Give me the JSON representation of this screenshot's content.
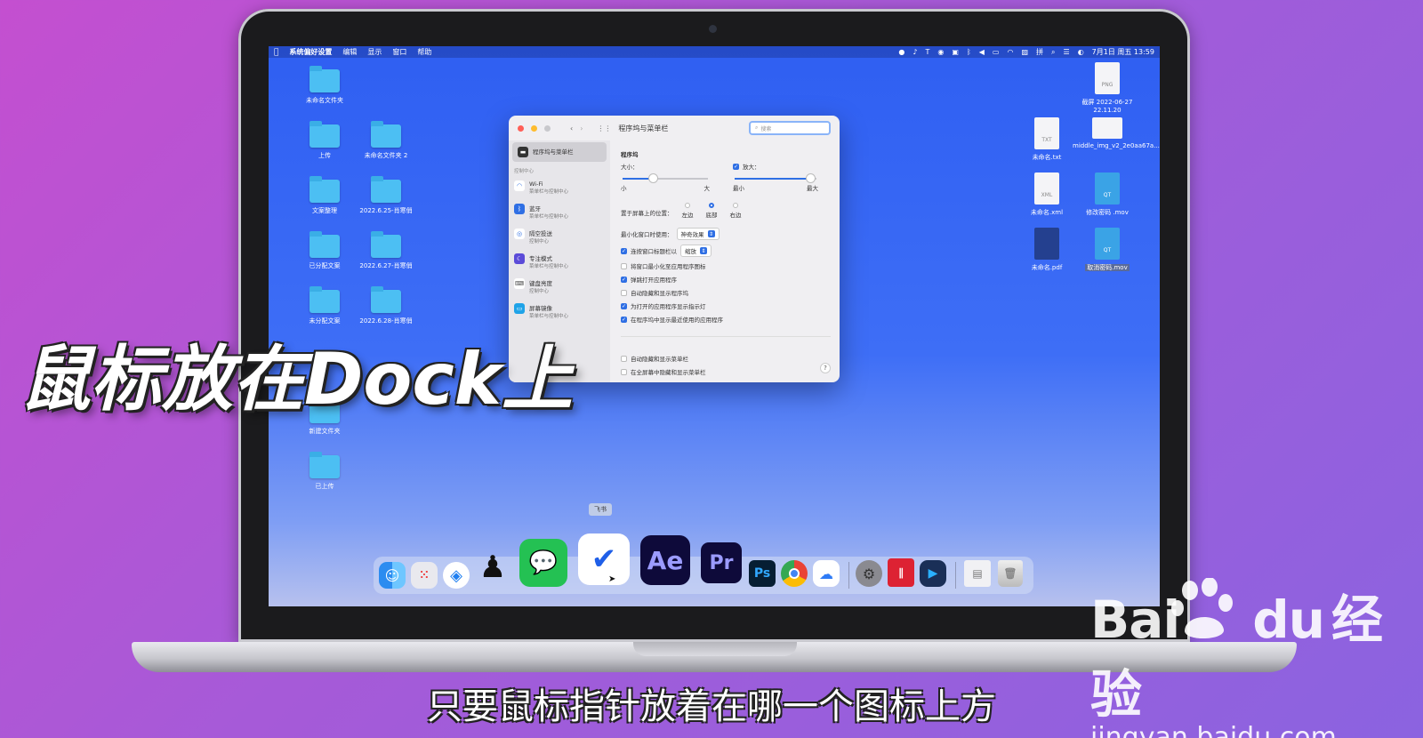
{
  "menubar": {
    "app": "系统偏好设置",
    "items": [
      "编辑",
      "显示",
      "窗口",
      "帮助"
    ],
    "clock": "7月1日 周五 13:59"
  },
  "desktop_left": [
    {
      "label": "未命名文件夹"
    },
    {
      "label": "上传"
    },
    {
      "label": "未命名文件夹 2"
    },
    {
      "label": "文案整理"
    },
    {
      "label": "2022.6.25-肖寒俏"
    },
    {
      "label": "已分配文案"
    },
    {
      "label": "2022.6.27-肖寒俏"
    },
    {
      "label": "未分配文案"
    },
    {
      "label": "2022.6.28-肖寒俏"
    },
    {
      "label": "新建文件夹"
    },
    {
      "label": "已上传"
    }
  ],
  "desktop_right": [
    {
      "label": "截屏 2022-06-27 22.11.20",
      "tag": "PNG"
    },
    {
      "label": "未命名.txt",
      "tag": "TXT"
    },
    {
      "label": "middle_img_v2_2e0aa67a...09g.png",
      "tag": ""
    },
    {
      "label": "未命名.xml",
      "tag": "XML"
    },
    {
      "label": "修改密码 .mov",
      "tag": "QT"
    },
    {
      "label": "未命名.pdf",
      "tag": ""
    },
    {
      "label": "取消密码.mov",
      "tag": "QT"
    }
  ],
  "prefs": {
    "title": "程序坞与菜单栏",
    "search_placeholder": "搜索",
    "sidebar": {
      "selected": "程序坞与菜单栏",
      "group": "控制中心",
      "items": [
        {
          "label": "Wi-Fi",
          "sub": "菜单栏与控制中心"
        },
        {
          "label": "蓝牙",
          "sub": "菜单栏与控制中心"
        },
        {
          "label": "隔空投送",
          "sub": "控制中心"
        },
        {
          "label": "专注模式",
          "sub": "菜单栏与控制中心"
        },
        {
          "label": "键盘亮度",
          "sub": "控制中心"
        },
        {
          "label": "屏幕镜像",
          "sub": "菜单栏与控制中心"
        }
      ]
    },
    "section": "程序坞",
    "size_label": "大小：",
    "size_small": "小",
    "size_large": "大",
    "size_value": 0.35,
    "magnify_label": "放大：",
    "magnify_min": "最小",
    "magnify_max": "最大",
    "magnify_value": 0.92,
    "position_label": "置于屏幕上的位置：",
    "positions": [
      "左边",
      "底部",
      "右边"
    ],
    "minimize_label": "最小化窗口时使用：",
    "minimize_value": "神奇效果",
    "dblclick_label": "连按窗口标题栏以",
    "dblclick_value": "缩放",
    "options": [
      {
        "label": "将窗口最小化至应用程序图标",
        "checked": false
      },
      {
        "label": "弹跳打开应用程序",
        "checked": true
      },
      {
        "label": "自动隐藏和显示程序坞",
        "checked": false
      },
      {
        "label": "为打开的应用程序显示指示灯",
        "checked": true
      },
      {
        "label": "在程序坞中显示最近使用的应用程序",
        "checked": true
      }
    ],
    "menubar_options": [
      "自动隐藏和显示菜单栏",
      "在全屏幕中隐藏和显示菜单栏"
    ],
    "help": "?"
  },
  "dock": {
    "tooltip": "飞书",
    "apps": [
      {
        "name": "finder",
        "label": ""
      },
      {
        "name": "launchpad",
        "label": ""
      },
      {
        "name": "safari",
        "label": ""
      },
      {
        "name": "qq",
        "label": ""
      },
      {
        "name": "wechat",
        "label": ""
      },
      {
        "name": "feishu",
        "label": ""
      },
      {
        "name": "after-effects",
        "label": "Ae"
      },
      {
        "name": "premiere",
        "label": "Pr"
      },
      {
        "name": "photoshop",
        "label": "Ps"
      },
      {
        "name": "chrome",
        "label": ""
      },
      {
        "name": "baidu-netdisk",
        "label": ""
      },
      {
        "name": "system-preferences",
        "label": ""
      },
      {
        "name": "parallels",
        "label": ""
      },
      {
        "name": "player",
        "label": ""
      },
      {
        "name": "preview",
        "label": ""
      },
      {
        "name": "trash",
        "label": ""
      }
    ]
  },
  "overlay": {
    "caption": "鼠标放在Dock上",
    "subtitle": "只要鼠标指针放着在哪一个图标上方"
  },
  "watermark": {
    "brand_a": "Bai",
    "brand_b": "du",
    "brand_c": "经验",
    "url": "jingyan.baidu.com"
  }
}
